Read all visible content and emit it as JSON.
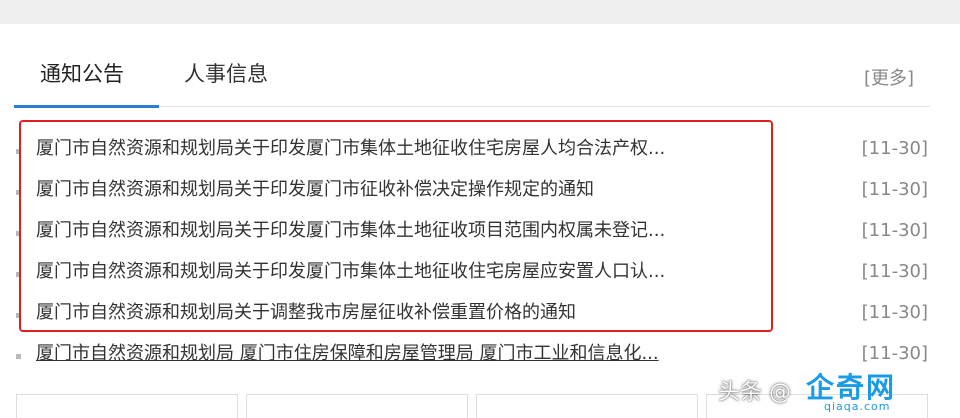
{
  "tabs": [
    {
      "label": "通知公告",
      "active": true
    },
    {
      "label": "人事信息",
      "active": false
    }
  ],
  "more_label": "[更多]",
  "items": [
    {
      "title": "厦门市自然资源和规划局关于印发厦门市集体土地征收住宅房屋人均合法产权...",
      "date": "[11-30]"
    },
    {
      "title": "厦门市自然资源和规划局关于印发厦门市征收补偿决定操作规定的通知",
      "date": "[11-30]"
    },
    {
      "title": "厦门市自然资源和规划局关于印发厦门市集体土地征收项目范围内权属未登记...",
      "date": "[11-30]"
    },
    {
      "title": "厦门市自然资源和规划局关于印发厦门市集体土地征收住宅房屋应安置人口认...",
      "date": "[11-30]"
    },
    {
      "title": "厦门市自然资源和规划局关于调整我市房屋征收补偿重置价格的通知",
      "date": "[11-30]"
    },
    {
      "title": "厦门市自然资源和规划局 厦门市住房保障和房屋管理局 厦门市工业和信息化...",
      "date": "[11-30]"
    }
  ],
  "watermark": {
    "text": "头条 @",
    "logo": "企奇网",
    "sub": "qiaqa.com"
  },
  "colors": {
    "accent": "#2b7fd0",
    "highlight_border": "#e02020"
  }
}
